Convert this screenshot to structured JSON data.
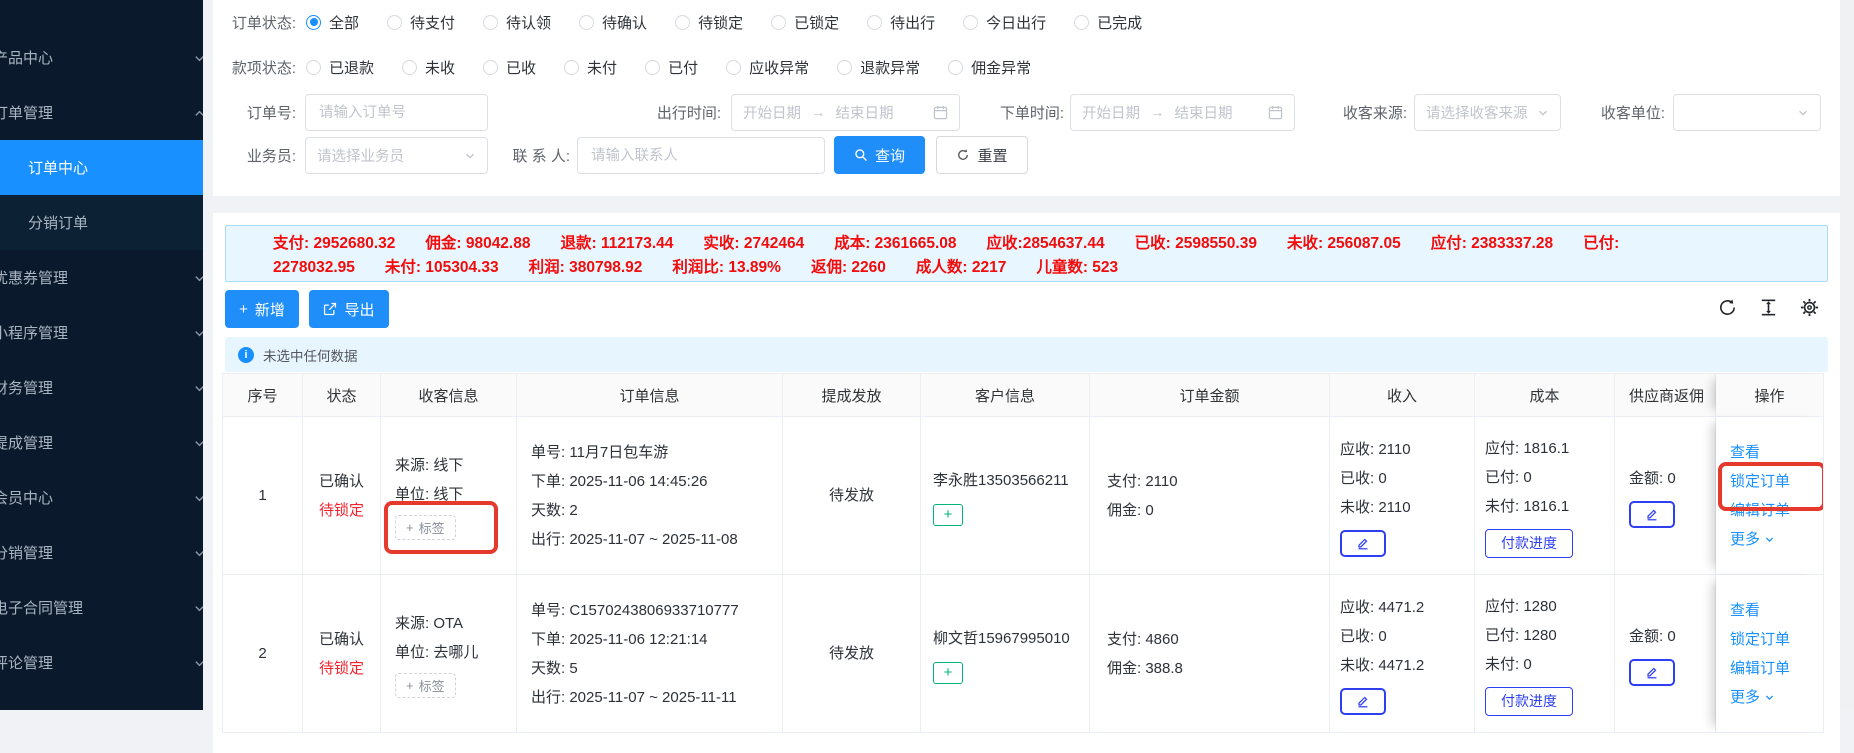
{
  "sidebar": {
    "items": [
      {
        "label": "产品中心"
      },
      {
        "label": "订单管理"
      },
      {
        "label": "订单中心"
      },
      {
        "label": "分销订单"
      },
      {
        "label": "优惠券管理"
      },
      {
        "label": "小程序管理"
      },
      {
        "label": "财务管理"
      },
      {
        "label": "提成管理"
      },
      {
        "label": "会员中心"
      },
      {
        "label": "分销管理"
      },
      {
        "label": "电子合同管理"
      },
      {
        "label": "评论管理"
      }
    ]
  },
  "filters": {
    "order_status": {
      "label": "订单状态:",
      "options": [
        {
          "label": "全部",
          "checked": true
        },
        {
          "label": "待支付"
        },
        {
          "label": "待认领"
        },
        {
          "label": "待确认"
        },
        {
          "label": "待锁定"
        },
        {
          "label": "已锁定"
        },
        {
          "label": "待出行"
        },
        {
          "label": "今日出行"
        },
        {
          "label": "已完成"
        }
      ]
    },
    "payment_status": {
      "label": "款项状态:",
      "options": [
        {
          "label": "已退款"
        },
        {
          "label": "未收"
        },
        {
          "label": "已收"
        },
        {
          "label": "未付"
        },
        {
          "label": "已付"
        },
        {
          "label": "应收异常"
        },
        {
          "label": "退款异常"
        },
        {
          "label": "佣金异常"
        }
      ]
    },
    "order_no": {
      "label": "订单号:",
      "placeholder": "请输入订单号"
    },
    "travel_time": {
      "label": "出行时间:",
      "start": "开始日期",
      "end": "结束日期"
    },
    "order_time": {
      "label": "下单时间:",
      "start": "开始日期",
      "end": "结束日期"
    },
    "source": {
      "label": "收客来源:",
      "placeholder": "请选择收客来源"
    },
    "unit": {
      "label": "收客单位:"
    },
    "salesman": {
      "label": "业务员:",
      "placeholder": "请选择业务员"
    },
    "contact": {
      "label": "联 系 人:",
      "placeholder": "请输入联系人"
    },
    "search": "查询",
    "reset": "重置"
  },
  "summary": {
    "line1": [
      "支付: 2952680.32",
      "佣金: 98042.88",
      "退款: 112173.44",
      "实收: 2742464",
      "成本: 2361665.08",
      "应收:2854637.44",
      "已收: 2598550.39",
      "未收: 256087.05",
      "应付: 2383337.28",
      "已付:"
    ],
    "line2": [
      "2278032.95",
      "未付: 105304.33",
      "利润: 380798.92",
      "利润比: 13.89%",
      "返佣: 2260",
      "成人数: 2217",
      "儿童数: 523"
    ]
  },
  "toolbar": {
    "add": "新增",
    "export": "导出"
  },
  "alert": {
    "text": "未选中任何数据"
  },
  "table": {
    "headers": [
      "序号",
      "状态",
      "收客信息",
      "订单信息",
      "提成发放",
      "客户信息",
      "订单金额",
      "收入",
      "成本",
      "供应商返佣",
      "操作"
    ],
    "pay_progress_label": "付款进度",
    "tag_label": "标签",
    "rows": [
      {
        "index": "1",
        "status_main": "已确认",
        "status_sub": "待锁定",
        "source": "来源: 线下",
        "unit": "单位: 线下",
        "order_no": "单号: 11月7日包车游",
        "order_time": "下单: 2025-11-06 14:45:26",
        "days": "天数: 2",
        "trip": "出行: 2025-11-07 ~ 2025-11-08",
        "commission_status": "待发放",
        "customer": "李永胜13503566211",
        "pay": "支付: 2110",
        "commission": "佣金: 0",
        "recv_due": "应收: 2110",
        "recv_got": "已收: 0",
        "recv_left": "未收: 2110",
        "cost_due": "应付: 1816.1",
        "cost_paid": "已付: 0",
        "cost_left": "未付: 1816.1",
        "supplier_amount": "金额: 0",
        "actions": {
          "view": "查看",
          "lock": "锁定订单",
          "edit": "编辑订单",
          "more": "更多"
        }
      },
      {
        "index": "2",
        "status_main": "已确认",
        "status_sub": "待锁定",
        "source": "来源: OTA",
        "unit": "单位: 去哪儿",
        "order_no": "单号: C1570243806933710777",
        "order_time": "下单: 2025-11-06 12:21:14",
        "days": "天数: 5",
        "trip": "出行: 2025-11-07 ~ 2025-11-11",
        "commission_status": "待发放",
        "customer": "柳文哲15967995010",
        "pay": "支付: 4860",
        "commission": "佣金: 388.8",
        "recv_due": "应收: 4471.2",
        "recv_got": "已收: 0",
        "recv_left": "未收: 4471.2",
        "cost_due": "应付: 1280",
        "cost_paid": "已付: 1280",
        "cost_left": "未付: 0",
        "supplier_amount": "金额: 0",
        "actions": {
          "view": "查看",
          "lock": "锁定订单",
          "edit": "编辑订单",
          "more": "更多"
        }
      }
    ]
  }
}
